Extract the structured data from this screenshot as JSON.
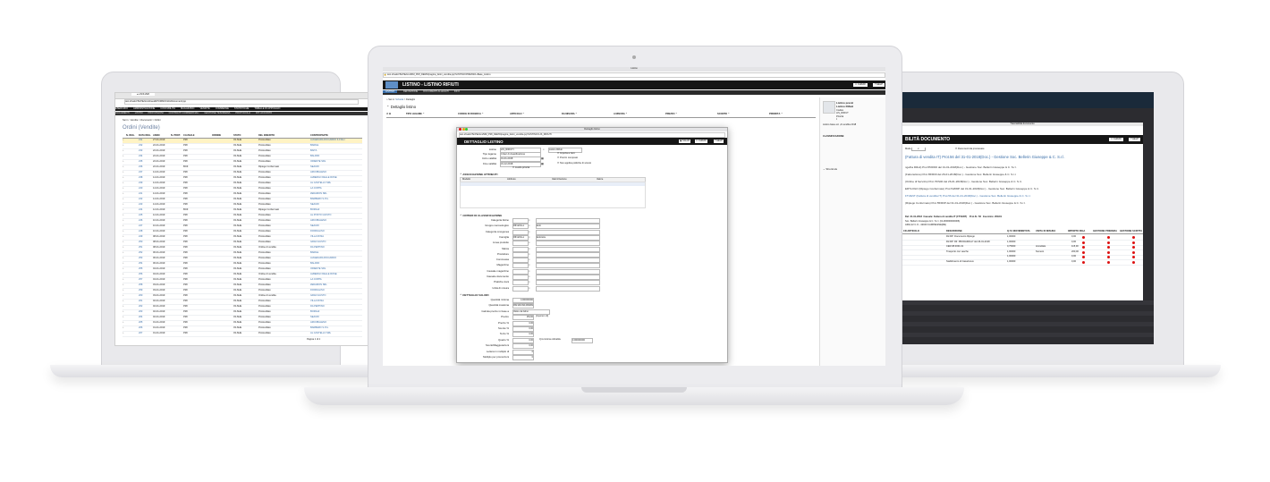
{
  "left": {
    "url": "test.sfnatic/?ErPE/stm/sheet/ETF/MM/Ordini/Documenti.jsp",
    "nav": [
      "ESERCIZIO",
      "AMMINISTRAZIONE",
      "CONTABILITÀ",
      "MAGAZZINO",
      "VENDITE",
      "COMMESSE",
      "STATISTICHE",
      "TABELLE DI APPOGGIO"
    ],
    "subnav": [
      "DOCUMENTI",
      "LISTINI",
      "PROVVIGIONI",
      "CONTRATTI COMMERCIALI",
      "GESTIONE TESORERIA",
      "PROTOCOLLI",
      "RIT. ACCONTO"
    ],
    "breadcrumb": "Sei in : Vendite > Documenti > Ordini",
    "title": "Ordini (Vendite)",
    "columns": [
      "N. REG.",
      "DATA REG.",
      "ANNO",
      "N. PROT.",
      "CAUSALE",
      "ORDINE",
      "STATO",
      "DEL INSERITO",
      "CONTROPARTE"
    ],
    "rows": [
      {
        "n": "231",
        "data": "27-01-2019",
        "c1": "PMI",
        "c2": "03-SHE",
        "s": "Protocollato",
        "p": "AUGEDARA RICCARDO & FIGLI"
      },
      {
        "n": "232",
        "data": "22-01-2019",
        "c1": "PMI",
        "c2": "03-SHE",
        "s": "Protocollato",
        "p": "BARILE"
      },
      {
        "n": "233",
        "data": "22-01-2019",
        "c1": "PMI",
        "c2": "03-SHE",
        "s": "Protocollato",
        "p": "BAITA"
      },
      {
        "n": "234",
        "data": "22-01-2019",
        "c1": "PMI",
        "c2": "03-SHE",
        "s": "Protocollato",
        "p": "BALDINI"
      },
      {
        "n": "235",
        "data": "22-01-2019",
        "c1": "PMI",
        "c2": "03-SHE",
        "s": "Protocollato",
        "p": "ORIENTE SRL"
      },
      {
        "n": "236",
        "data": "22-01-2019",
        "c1": "BOZ",
        "c2": "03-SHE",
        "s": "Ripiego Confermato",
        "p": "SEAURI"
      },
      {
        "n": "237",
        "data": "14-01-2019",
        "c1": "PMI",
        "c2": "03-SHE",
        "s": "Protocollato",
        "p": "ARCOBALENO"
      },
      {
        "n": "238",
        "data": "14-01-2019",
        "c1": "PMI",
        "c2": "03-SHE",
        "s": "Protocollato",
        "p": "ALBERGO DELLE ROSE"
      },
      {
        "n": "239",
        "data": "14-01-2019",
        "c1": "PMI",
        "c2": "03-SHE",
        "s": "Protocollato",
        "p": "AL CASTELLO SRL"
      },
      {
        "n": "240",
        "data": "14-01-2019",
        "c1": "PMI",
        "c2": "03-SHE",
        "s": "Protocollato",
        "p": "LA COPPA"
      },
      {
        "n": "241",
        "data": "14-01-2019",
        "c1": "PMI",
        "c2": "03-SHE",
        "s": "Protocollato",
        "p": "ZEDAMON SRL"
      },
      {
        "n": "242",
        "data": "14-01-2019",
        "c1": "PMI",
        "c2": "03-SHE",
        "s": "Protocollato",
        "p": "BARBERO S.P.A."
      },
      {
        "n": "243",
        "data": "14-01-2019",
        "c1": "PMI",
        "c2": "03-SHE",
        "s": "Protocollato",
        "p": "SEAURI"
      },
      {
        "n": "244",
        "data": "12-01-2019",
        "c1": "BOZ",
        "c2": "03-SHE",
        "s": "Ripiego Confermato",
        "p": "BORGHI"
      },
      {
        "n": "245",
        "data": "12-01-2019",
        "c1": "PMI",
        "c2": "03-SHE",
        "s": "Protocollato",
        "p": "AL POSTO GIUSTO"
      },
      {
        "n": "246",
        "data": "10-01-2019",
        "c1": "PMI",
        "c2": "03-SHE",
        "s": "Protocollato",
        "p": "ARCOBALENO"
      },
      {
        "n": "247",
        "data": "10-01-2019",
        "c1": "PMI",
        "c2": "03-SHE",
        "s": "Protocollato",
        "p": "SEAURI"
      },
      {
        "n": "248",
        "data": "10-01-2019",
        "c1": "PMI",
        "c2": "03-SHE",
        "s": "Protocollato",
        "p": "FIORDALISO"
      },
      {
        "n": "249",
        "data": "08-01-2019",
        "c1": "PMI",
        "c2": "03-SHE",
        "s": "Protocollato",
        "p": "VILLA ROSA"
      },
      {
        "n": "250",
        "data": "08-01-2019",
        "c1": "PMI",
        "c2": "03-SHE",
        "s": "Protocollato",
        "p": "GRAN GUSTO"
      },
      {
        "n": "251",
        "data": "08-01-2019",
        "c1": "PMI",
        "c2": "03-SHE",
        "s": "Ordine di vendita",
        "p": "DA PEPPINO"
      },
      {
        "n": "252",
        "data": "06-01-2019",
        "c1": "PMI",
        "c2": "03-SHE",
        "s": "Protocollato",
        "p": "BARILE"
      },
      {
        "n": "253",
        "data": "06-01-2019",
        "c1": "PMI",
        "c2": "03-SHE",
        "s": "Protocollato",
        "p": "AUGEDARA RICCARDO"
      },
      {
        "n": "254",
        "data": "06-01-2019",
        "c1": "PMI",
        "c2": "03-SHE",
        "s": "Protocollato",
        "p": "BALDINI"
      },
      {
        "n": "255",
        "data": "04-01-2019",
        "c1": "PMI",
        "c2": "03-SHE",
        "s": "Protocollato",
        "p": "ORIENTE SRL"
      },
      {
        "n": "256",
        "data": "04-01-2019",
        "c1": "PMI",
        "c2": "03-SHE",
        "s": "Ordine di vendita",
        "p": "ALBERGO DELLE ROSE"
      },
      {
        "n": "257",
        "data": "04-01-2019",
        "c1": "PMI",
        "c2": "03-SHE",
        "s": "Protocollato",
        "p": "LA COPPA"
      },
      {
        "n": "258",
        "data": "03-01-2019",
        "c1": "PMI",
        "c2": "03-SHE",
        "s": "Protocollato",
        "p": "ZEDAMON SRL"
      },
      {
        "n": "259",
        "data": "03-01-2019",
        "c1": "PMI",
        "c2": "03-SHE",
        "s": "Protocollato",
        "p": "FIORDALISO"
      },
      {
        "n": "260",
        "data": "03-01-2019",
        "c1": "PMI",
        "c2": "03-SHE",
        "s": "Ordine di vendita",
        "p": "GRAN GUSTO"
      },
      {
        "n": "261",
        "data": "02-01-2019",
        "c1": "PMI",
        "c2": "03-SHE",
        "s": "Protocollato",
        "p": "VILLA ROSA"
      },
      {
        "n": "262",
        "data": "02-01-2019",
        "c1": "PMI",
        "c2": "03-SHE",
        "s": "Protocollato",
        "p": "DA PEPPINO"
      },
      {
        "n": "263",
        "data": "02-01-2019",
        "c1": "PMI",
        "c2": "03-SHE",
        "s": "Protocollato",
        "p": "BORGHI"
      },
      {
        "n": "264",
        "data": "02-01-2019",
        "c1": "PMI",
        "c2": "03-SHE",
        "s": "Protocollato",
        "p": "SEAURI"
      },
      {
        "n": "265",
        "data": "01-01-2019",
        "c1": "PMI",
        "c2": "03-SHE",
        "s": "Protocollato",
        "p": "ARCOBALENO"
      },
      {
        "n": "266",
        "data": "01-01-2019",
        "c1": "PMI",
        "c2": "03-SHE",
        "s": "Protocollato",
        "p": "BARBERO S.P.A."
      },
      {
        "n": "267",
        "data": "01-01-2019",
        "c1": "PMI",
        "c2": "03-SHE",
        "s": "Protocollato",
        "p": "AL CASTELLO SRL"
      }
    ],
    "footer": "Pagina 1 di 1"
  },
  "center": {
    "window_title": "Listino",
    "url": "test.sfnatic/?ErPE/stm/MM_PMI_DEMO/pagina_listini_vendita.jsp?LISTINO=PRESSO+Base_Listino",
    "app_title": "LISTINO - LISTINO RIFIUTI",
    "chiudi": "CHIUDI",
    "help": "HELP",
    "menu": [
      "DEFINIZIONE",
      "DOCUMENTI ALLEGATI",
      "INFO"
    ],
    "breadcrumb_prefix": "Sei in:",
    "breadcrumb_link": "Scheda",
    "breadcrumb_current": "Dettaglio",
    "section_title": "Dettaglio listino",
    "grid_cols": [
      "TIPO LEGAME",
      "CODICE DI RICERCA",
      "ARTICOLO",
      "DA MISURA",
      "A MISURA",
      "PREZZO",
      "SCONTO",
      "PRIORITÀ"
    ],
    "side": {
      "title1": "Listino prezzi",
      "title2": "Listino Rifiuti",
      "codice_lbl": "Codice",
      "codice": "LIS_RIFIUTI",
      "priorita_lbl": "Priorità",
      "priorita": "4",
      "note": "Listino base ed. ,di vendita 2018"
    },
    "side_class": "CLASSIFICAZIONE",
    "side_shortcuts": "Shortcuts",
    "dialog": {
      "window_title": "Dettaglio listino",
      "url": "test.sfnatic/?ErPE/stm/MM_PMI_DEMO/pagina_listini_vendita.jsp?LISTINO=LIS_RIFIUTI",
      "title": "DETTAGLIO LISTINO",
      "btn_salva": "SALVA",
      "btn_chiudi": "CHIUDI",
      "btn_help": "HELP",
      "fields": [
        {
          "label": "Listino",
          "value": "LIS_RIFIUTI",
          "extra": "Listino Rifiuti"
        },
        {
          "label": "Tipo legame",
          "value": "Criteri di classificazione",
          "extra": "Importa a zero"
        },
        {
          "label": "Inizio validità",
          "value": "01-01-2018",
          "extra": "Prezzo composto"
        },
        {
          "label": "Fine validità",
          "value": "31-12-2018",
          "extra": "Non applica politiche di sconto"
        },
        {
          "label": "",
          "value": "",
          "extra": "Livello priorità"
        }
      ],
      "assoc_title": "ASSOCIAZIONE ATTRIBUTI",
      "assoc_cols": [
        "Modello",
        "Attributo",
        "Valorizzazione",
        "Valore"
      ],
      "class_title": "CRITERI DI CLASSIFICAZIONE",
      "class_rows": [
        {
          "label": "Categoria listino",
          "value": "",
          "desc": ""
        },
        {
          "label": "Gruppo merceologico",
          "value": "RIF-EOLLo",
          "desc": "Eolo"
        },
        {
          "label": "Categoria omogenea",
          "value": "",
          "desc": ""
        },
        {
          "label": "Famiglia",
          "value": "RIF-EOLLo",
          "desc": "Eolocarte"
        },
        {
          "label": "Linea prodotto",
          "value": "",
          "desc": ""
        },
        {
          "label": "Marca",
          "value": "",
          "desc": ""
        },
        {
          "label": "Produttore",
          "value": "",
          "desc": ""
        },
        {
          "label": "Commessa",
          "value": "",
          "desc": ""
        },
        {
          "label": "Magazzino",
          "value": "",
          "desc": ""
        },
        {
          "label": "Causale magazzino",
          "value": "",
          "desc": ""
        },
        {
          "label": "Causale documento",
          "value": "",
          "desc": ""
        },
        {
          "label": "Pratiche ciani",
          "value": "",
          "desc": ""
        },
        {
          "label": "Unità di misura",
          "value": "",
          "desc": ""
        }
      ],
      "values_title": "DETTAGLIO VALORI",
      "value_rows": [
        {
          "label": "Quantità minima",
          "value": "0,000000000"
        },
        {
          "label": "Quantità massima",
          "value": "999.999.999,999999999"
        },
        {
          "label": "Calcola prezzo in base a",
          "value": "Valore da listino"
        },
        {
          "label": "Prezzo",
          "value": "153,00"
        },
        {
          "label": "Prezzo %",
          "value": "0,00"
        },
        {
          "label": "Sconto %",
          "value": "0,00"
        },
        {
          "label": "Terzo %",
          "value": "0,00"
        },
        {
          "label": "Quarto %",
          "value": "0,00"
        },
        {
          "label": "Sconti/Maggiorazioni",
          "value": "0,00"
        },
        {
          "label": "Lettera in multiplo di",
          "value": "0"
        },
        {
          "label": "Multiplo per promozioni",
          "value": "0"
        }
      ],
      "extra_prezzo": "(Importo in €)",
      "extra_quarto_lbl": "Q.tà minima ordinabile",
      "extra_quarto_val": "0,000000000"
    }
  },
  "right": {
    "top_title": "Tracciabilità documento",
    "app_title": "BILITÀ DOCUMENTO",
    "chiudi": "CHIUDI",
    "help": "HELP",
    "mode": "Mode",
    "check": "Documenti da processare",
    "doc_head": "(Fattura di vendita IT) Prot.56 del 31-01-2018(Doc.) - Gestione Soc. Bellerin Giuseppe & C. S.r.l.",
    "tree": [
      "ngelha Rifiuti) Prot.55/R/00 del 31-01-2018(Doc.) - Gestione Soc. Bellerin Giuseppe & C. S.r.l.",
      "(Fatturazione) Prot.65/R00 del 26-01-2018(Doc.) - Gestione Soc. Bellerin Giuseppe & C. S.r.l.",
      "(Ordine di Servizio) Prot.70/S00 del 26-01-2018(Doc.) - Gestione Soc. Bellerin Giuseppe & C. S.r.l.",
      "ERTLOGO (Ripiego Confermato) Prot.54/R0P del 31-01-2018(Doc.) - Gestione Soc. Bellerin Giuseppe & C. S.r.l.",
      "FTVENT (Fattura di vendita IT) Prot.56 del 31-01-2018(Doc.) - Gestione Soc. Bellerin Giuseppe & C. S.r.l.",
      "(Ripiego Confermato) Prot.55/R0P del 31-01-2018(Doc.) - Gestione Soc. Bellerin Giuseppe & C. S.r.l."
    ],
    "info_del": "Del: 31-01-2018",
    "info_causale": "Causale: Fattura di vendita IT (FTVENT)",
    "info_prot": "Prot.N.: 56",
    "info_esercizio": "Esercizio: 2018/1",
    "info_soc": "Soc. Bellerin Giuseppe & C. S.r.l. (CL000000000006)",
    "info_addr": "ARIA,22 C.O.- 42040 CAMPEGINE(RE)",
    "cols": [
      "CD ARTICOLO",
      "DESCRIZIONE",
      "Q.TÀ MOVIMENTATA",
      "UNITÀ DI MISURA",
      "IMPORTO RIGA",
      "GESTIONE PRIMARIA",
      "GESTIONE SCRITTA"
    ],
    "lines": [
      {
        "desc": "Rd RP: Documento Ripiego",
        "qty": "1,00000",
        "um": "",
        "imp": "0,00"
      },
      {
        "desc": "Rd RP: Rif. PRODAMIA17 del 26-01-2018",
        "qty": "1,00000",
        "um": "",
        "imp": "0,00"
      },
      {
        "desc": "CER.08.0001.01",
        "qty": "0,75000",
        "um": "tonnellate",
        "imp": "115,00"
      },
      {
        "desc": "Trasporto con vasche",
        "qty": "1,00000",
        "um": "Numero",
        "imp": "200,00"
      },
      {
        "desc": "",
        "qty": "1,00000",
        "um": "",
        "imp": "0,00"
      },
      {
        "desc": "Stabilimento di Casarinove",
        "qty": "1,00000",
        "um": "",
        "imp": "0,00"
      }
    ]
  }
}
